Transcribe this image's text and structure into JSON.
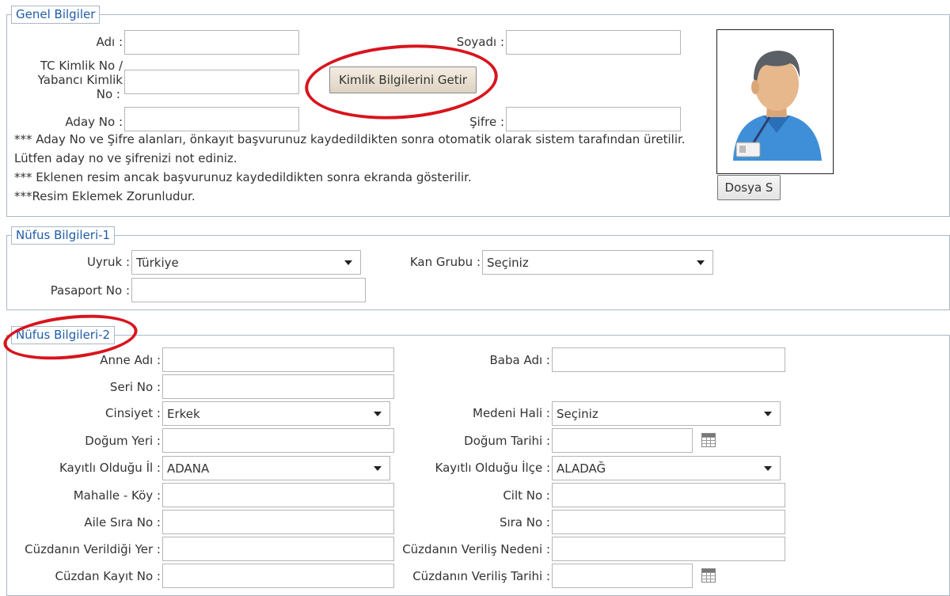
{
  "genel": {
    "legend": "Genel Bilgiler",
    "adi_label": "Adı :",
    "soyadi_label": "Soyadı :",
    "tc_label_1": "TC Kimlik No /",
    "tc_label_2": "Yabancı Kimlik",
    "tc_label_3": "No :",
    "kimlik_button": "Kimlik Bilgilerini Getir",
    "aday_label": "Aday No :",
    "sifre_label": "Şifre :",
    "note1": "*** Aday No ve Şifre alanları, önkayıt başvurunuz kaydedildikten sonra otomatik olarak sistem tarafından üretilir.",
    "note2": "Lütfen aday no ve şifrenizi not ediniz.",
    "note3": "*** Eklenen resim ancak başvurunuz kaydedildikten sonra ekranda gösterilir.",
    "note4": "***Resim Eklemek Zorunludur.",
    "file_button": "Dosya S"
  },
  "nufus1": {
    "legend": "Nüfus Bilgileri-1",
    "uyruk_label": "Uyruk :",
    "uyruk_value": "Türkiye",
    "kan_label": "Kan Grubu :",
    "kan_value": "Seçiniz",
    "pasaport_label": "Pasaport No :"
  },
  "nufus2": {
    "legend": "Nüfus Bilgileri-2",
    "anne_label": "Anne Adı :",
    "baba_label": "Baba Adı :",
    "seri_label": "Seri No :",
    "cinsiyet_label": "Cinsiyet :",
    "cinsiyet_value": "Erkek",
    "medeni_label": "Medeni Hali :",
    "medeni_value": "Seçiniz",
    "dogumyeri_label": "Doğum Yeri :",
    "dogumtarihi_label": "Doğum Tarihi :",
    "il_label": "Kayıtlı Olduğu İl :",
    "il_value": "ADANA",
    "ilce_label": "Kayıtlı Olduğu İlçe :",
    "ilce_value": "ALADAĞ",
    "mahalle_label": "Mahalle - Köy :",
    "cilt_label": "Cilt No :",
    "aile_label": "Aile Sıra No :",
    "sira_label": "Sıra No :",
    "cuzdan_yer_label": "Cüzdanın Verildiği Yer :",
    "cuzdan_neden_label": "Cüzdanın Veriliş Nedeni :",
    "cuzdan_kayit_label": "Cüzdan Kayıt No :",
    "cuzdan_tarih_label": "Cüzdanın Veriliş Tarihi :"
  },
  "icons": {
    "avatar": "user-avatar-icon",
    "calendar": "calendar-icon",
    "dropdown": "chevron-down-icon"
  },
  "colors": {
    "legend_text": "#1f5da8",
    "highlight_circle": "#d8141d"
  }
}
